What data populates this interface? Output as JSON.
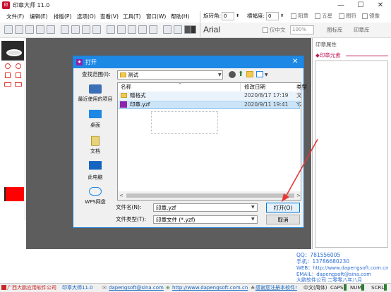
{
  "app": {
    "logo": "印章",
    "title": "印章大师 11.0",
    "window_buttons": [
      "—",
      "☐",
      "✕"
    ]
  },
  "menu": [
    "文件(F)",
    "编辑(E)",
    "排版(P)",
    "选项(O)",
    "查看(V)",
    "工具(T)",
    "窗口(W)",
    "帮助(H)"
  ],
  "props": {
    "rotation_label": "旋转角:",
    "rotation_value": "0",
    "width_label": "横幅度:",
    "width_value": "0",
    "check1": "阳章",
    "check2": "五星",
    "check3": "图符",
    "check4": "镜像"
  },
  "toolbar": {
    "font": "Arial",
    "vertical": "仅中文",
    "zoom": "100%",
    "tab1": "图标库",
    "tab2": "印章库"
  },
  "right_panel": {
    "title": "印章属性",
    "element_label": "◆印章元素"
  },
  "dialog": {
    "title": "打开",
    "lookin_label": "查找范围(I):",
    "lookin_value": "测试",
    "columns": {
      "name": "名称",
      "date": "修改日期",
      "type": "类型"
    },
    "files": [
      {
        "name": "赠格式",
        "date": "2020/8/17 17:19",
        "type": "文件"
      },
      {
        "name": "印章.yzf",
        "date": "2020/9/11 19:41",
        "type": "YZ"
      }
    ],
    "places": [
      "最近使用的项目",
      "桌面",
      "文档",
      "此电脑",
      "WPS网盘"
    ],
    "filename_label": "文件名(N):",
    "filename_value": "印章.yzf",
    "filetype_label": "文件类型(T):",
    "filetype_value": "印章文件 (*.yzf)",
    "open_button": "打开(O)",
    "cancel_button": "取消"
  },
  "contact": {
    "qq": "QQ：781556005",
    "phone": "手机：13786680230",
    "web": "WEB：http://www.dapengsoft.com.cn",
    "email": "EMAIL：dapengsoft@sina.com",
    "company": "大鹏软件公司 二零零八年八月"
  },
  "status": {
    "company": "广西大鹏应用软件公司",
    "product": "印章大师11.0",
    "email": "dapengsoft@sina.com",
    "website": "http://www.dapengsoft.com.cn",
    "register": "感谢您注册本软件!",
    "ime": "中文(简体)",
    "caps": "CAPS",
    "num": "NUM",
    "scrl": "SCRL"
  },
  "colors": {
    "accent": "#1e88e5",
    "arrow": "#e53935",
    "stamp_red": "#ff0000",
    "workarea": "#5d5d5d",
    "selection": "#cce4f7"
  }
}
